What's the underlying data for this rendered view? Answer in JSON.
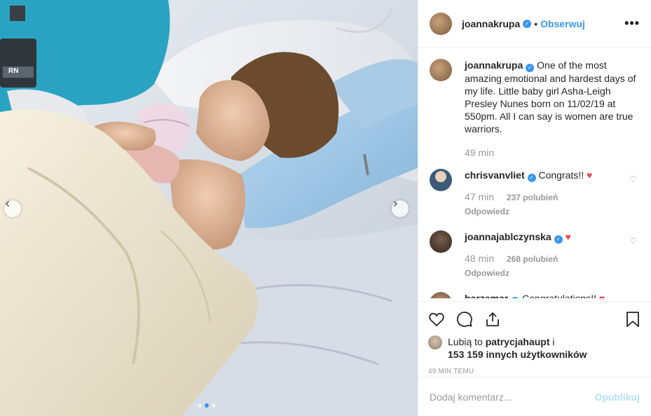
{
  "colors": {
    "accent": "#3897f0",
    "heart": "#ed4956",
    "muted": "#999999"
  },
  "photo": {
    "badge_label": "RN",
    "nav_prev_icon": "chevron-left-icon",
    "nav_next_icon": "chevron-right-icon",
    "carousel_dots": 3,
    "carousel_active": 2
  },
  "header": {
    "username": "joannakrupa",
    "separator": "•",
    "follow_label": "Obserwuj",
    "more_icon": "more-options-icon",
    "more_label": "•••"
  },
  "caption": {
    "username": "joannakrupa",
    "text": "One of the most amazing emotional and hardest days of my life. Little baby girl Asha-Leigh Presley Nunes born on 11/02/19 at 550pm. All I can say is women are true warriors.",
    "time": "49 min"
  },
  "comments": [
    {
      "username": "chrisvanvliet",
      "text": "Congrats!!",
      "time": "47 min",
      "likes": "237 polubień",
      "reply": "Odpowiedz"
    },
    {
      "username": "joannajablczynska",
      "text": "",
      "time": "48 min",
      "likes": "268 polubień",
      "reply": "Odpowiedz"
    },
    {
      "username": "barzamar",
      "text": "Congratulations!!"
    }
  ],
  "actions": {
    "like_icon": "heart-outline-icon",
    "comment_icon": "comment-icon",
    "share_icon": "share-icon",
    "bookmark_icon": "bookmark-icon"
  },
  "likes": {
    "prefix": "Lubią to",
    "user": "patrycjahaupt",
    "joiner": "i",
    "others": "153 159 innych użytkowników"
  },
  "post_time": "49 MIN TEMU",
  "add_comment": {
    "placeholder": "Dodaj komentarz...",
    "publish_label": "Opublikuj"
  }
}
